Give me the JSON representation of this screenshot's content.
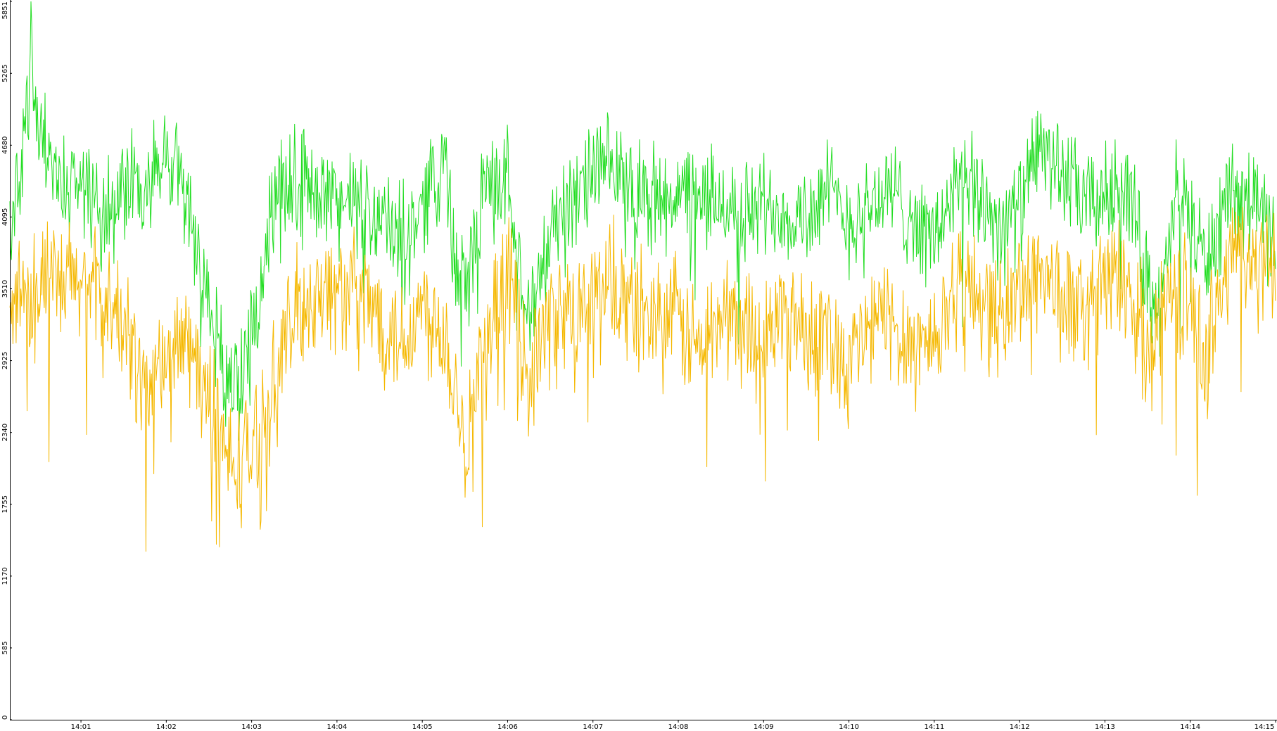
{
  "chart_data": {
    "type": "line",
    "title": "",
    "xlabel": "",
    "ylabel": "",
    "ylim": [
      0,
      5851
    ],
    "y_ticks": [
      0,
      585,
      1170,
      1755,
      2340,
      2925,
      3510,
      4095,
      4680,
      5265,
      5851
    ],
    "x_ticks": [
      "14:01",
      "14:02",
      "14:03",
      "14:04",
      "14:05",
      "14:06",
      "14:07",
      "14:08",
      "14:09",
      "14:10",
      "14:11",
      "14:12",
      "14:13",
      "14:14",
      "14:15"
    ],
    "xlim": [
      "14:00:10",
      "14:15:00"
    ],
    "grid": false,
    "legend": "none",
    "series": [
      {
        "color": "#22dd22",
        "anchors": [
          [
            "14:00:10",
            3900
          ],
          [
            "14:00:20",
            4700
          ],
          [
            "14:00:25",
            5400
          ],
          [
            "14:00:30",
            4800
          ],
          [
            "14:00:45",
            4300
          ],
          [
            "14:01:00",
            4400
          ],
          [
            "14:01:15",
            4200
          ],
          [
            "14:01:30",
            4350
          ],
          [
            "14:01:45",
            4300
          ],
          [
            "14:02:00",
            4550
          ],
          [
            "14:02:10",
            4450
          ],
          [
            "14:02:20",
            3900
          ],
          [
            "14:02:30",
            3400
          ],
          [
            "14:02:40",
            2850
          ],
          [
            "14:02:50",
            2700
          ],
          [
            "14:03:00",
            3100
          ],
          [
            "14:03:10",
            3900
          ],
          [
            "14:03:20",
            4300
          ],
          [
            "14:03:30",
            4450
          ],
          [
            "14:03:45",
            4350
          ],
          [
            "14:04:00",
            4250
          ],
          [
            "14:04:15",
            4150
          ],
          [
            "14:04:30",
            4100
          ],
          [
            "14:04:45",
            3900
          ],
          [
            "14:05:00",
            4200
          ],
          [
            "14:05:15",
            4650
          ],
          [
            "14:05:25",
            3500
          ],
          [
            "14:05:35",
            3800
          ],
          [
            "14:05:45",
            4350
          ],
          [
            "14:06:00",
            4400
          ],
          [
            "14:06:10",
            3600
          ],
          [
            "14:06:20",
            3400
          ],
          [
            "14:06:35",
            4200
          ],
          [
            "14:06:50",
            4200
          ],
          [
            "14:07:00",
            4500
          ],
          [
            "14:07:15",
            4450
          ],
          [
            "14:07:30",
            4350
          ],
          [
            "14:07:45",
            4250
          ],
          [
            "14:08:00",
            4300
          ],
          [
            "14:08:15",
            4200
          ],
          [
            "14:08:30",
            4250
          ],
          [
            "14:08:45",
            4100
          ],
          [
            "14:09:00",
            4200
          ],
          [
            "14:09:15",
            4150
          ],
          [
            "14:09:30",
            4100
          ],
          [
            "14:09:45",
            4300
          ],
          [
            "14:10:00",
            4050
          ],
          [
            "14:10:15",
            4200
          ],
          [
            "14:10:30",
            4300
          ],
          [
            "14:10:45",
            4100
          ],
          [
            "14:11:00",
            3900
          ],
          [
            "14:11:15",
            4350
          ],
          [
            "14:11:30",
            4300
          ],
          [
            "14:11:45",
            4050
          ],
          [
            "14:12:00",
            4150
          ],
          [
            "14:12:15",
            4700
          ],
          [
            "14:12:30",
            4450
          ],
          [
            "14:12:45",
            4200
          ],
          [
            "14:13:00",
            4250
          ],
          [
            "14:13:15",
            4400
          ],
          [
            "14:13:30",
            3600
          ],
          [
            "14:13:40",
            3350
          ],
          [
            "14:13:50",
            4300
          ],
          [
            "14:14:00",
            4150
          ],
          [
            "14:14:10",
            3700
          ],
          [
            "14:14:20",
            4050
          ],
          [
            "14:14:30",
            4200
          ],
          [
            "14:14:45",
            4250
          ],
          [
            "14:15:00",
            3900
          ]
        ]
      },
      {
        "color": "#f5b800",
        "anchors": [
          [
            "14:00:10",
            3400
          ],
          [
            "14:00:30",
            3600
          ],
          [
            "14:00:45",
            3500
          ],
          [
            "14:01:00",
            3600
          ],
          [
            "14:01:15",
            3400
          ],
          [
            "14:01:30",
            3200
          ],
          [
            "14:01:45",
            2700
          ],
          [
            "14:02:00",
            2950
          ],
          [
            "14:02:15",
            3100
          ],
          [
            "14:02:30",
            2600
          ],
          [
            "14:02:45",
            2050
          ],
          [
            "14:03:00",
            2200
          ],
          [
            "14:03:15",
            2700
          ],
          [
            "14:03:30",
            3300
          ],
          [
            "14:03:45",
            3500
          ],
          [
            "14:04:00",
            3500
          ],
          [
            "14:04:15",
            3450
          ],
          [
            "14:04:30",
            3300
          ],
          [
            "14:04:45",
            3100
          ],
          [
            "14:05:00",
            3350
          ],
          [
            "14:05:15",
            3200
          ],
          [
            "14:05:30",
            2300
          ],
          [
            "14:05:45",
            3000
          ],
          [
            "14:06:00",
            3650
          ],
          [
            "14:06:15",
            2800
          ],
          [
            "14:06:30",
            3250
          ],
          [
            "14:06:45",
            3300
          ],
          [
            "14:07:00",
            3450
          ],
          [
            "14:07:15",
            3500
          ],
          [
            "14:07:30",
            3350
          ],
          [
            "14:07:45",
            3300
          ],
          [
            "14:08:00",
            3250
          ],
          [
            "14:08:15",
            3000
          ],
          [
            "14:08:30",
            3300
          ],
          [
            "14:08:45",
            3250
          ],
          [
            "14:09:00",
            3100
          ],
          [
            "14:09:15",
            3350
          ],
          [
            "14:09:30",
            3200
          ],
          [
            "14:09:45",
            3150
          ],
          [
            "14:10:00",
            2900
          ],
          [
            "14:10:15",
            3200
          ],
          [
            "14:10:30",
            3300
          ],
          [
            "14:10:45",
            3050
          ],
          [
            "14:11:00",
            3100
          ],
          [
            "14:11:15",
            3550
          ],
          [
            "14:11:30",
            3500
          ],
          [
            "14:11:45",
            3250
          ],
          [
            "14:12:00",
            3500
          ],
          [
            "14:12:15",
            3700
          ],
          [
            "14:12:30",
            3400
          ],
          [
            "14:12:45",
            3300
          ],
          [
            "14:13:00",
            3600
          ],
          [
            "14:13:15",
            3550
          ],
          [
            "14:13:30",
            3050
          ],
          [
            "14:13:45",
            3500
          ],
          [
            "14:14:00",
            3400
          ],
          [
            "14:14:10",
            2900
          ],
          [
            "14:14:20",
            3450
          ],
          [
            "14:14:30",
            3850
          ],
          [
            "14:14:45",
            3700
          ],
          [
            "14:15:00",
            3600
          ]
        ]
      }
    ]
  }
}
